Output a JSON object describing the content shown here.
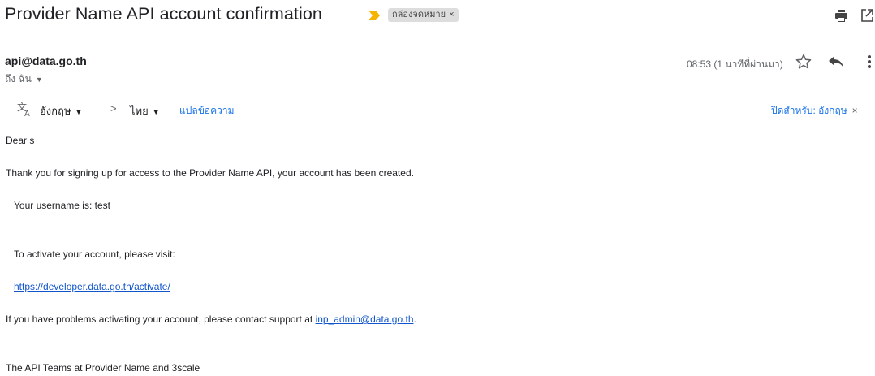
{
  "header": {
    "subject": "Provider Name API account confirmation",
    "label": "กล่องจดหมาย",
    "label_close": "×"
  },
  "sender": {
    "email": "api@data.go.th",
    "to": "ถึง ฉัน",
    "timestamp": "08:53 (1 นาทีที่ผ่านมา)"
  },
  "translate_bar": {
    "from_language": "อังกฤษ",
    "arrow": ">",
    "to_language": "ไทย",
    "translate_link": "แปลข้อความ",
    "turn_off": "ปิดสำหรับ: อังกฤษ",
    "close": "×"
  },
  "message": {
    "greeting": "Dear s",
    "intro": "Thank you for signing up for access to the Provider Name API, your account has been created.",
    "username_line": "Your username is: test",
    "activate_prompt": "To activate your account, please visit:",
    "activate_link": "https://developer.data.go.th/activate/",
    "support_prefix": "If you have problems activating your account, please contact support at ",
    "support_email": "inp_admin@data.go.th",
    "support_suffix": ".",
    "signature": "The API Teams at Provider Name and 3scale"
  },
  "colors": {
    "link": "#1155cc",
    "accent_blue": "#1a73e8",
    "important_marker": "#f4b400",
    "chip_bg": "#dddddd"
  },
  "icons": [
    "important-marker-icon",
    "print-icon",
    "new-window-icon",
    "star-icon",
    "reply-icon",
    "more-options-icon",
    "translate-icon",
    "chevron-down-icon"
  ]
}
